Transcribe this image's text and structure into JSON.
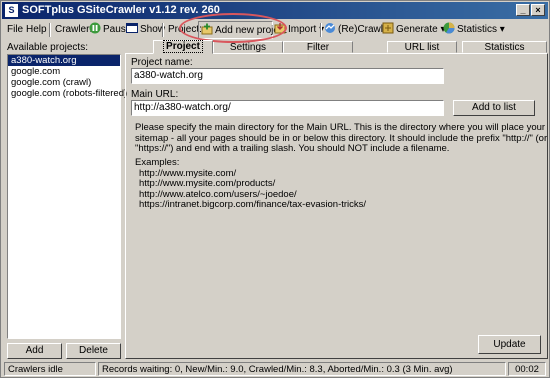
{
  "window": {
    "title": "SOFTplus GSiteCrawler v1.12 rev. 260"
  },
  "toolbar": {
    "file": "File",
    "help": "Help",
    "crawler_label": "Crawler:",
    "pause": "Pause",
    "show": "Show",
    "project_label": "Project:",
    "add_new_project": "Add new project",
    "import": "Import",
    "recrawl": "(Re)Crawl",
    "generate": "Generate",
    "statistics": "Statistics"
  },
  "sidebar": {
    "label": "Available projects:",
    "projects": [
      "a380-watch.org",
      "google.com",
      "google.com (crawl)",
      "google.com (robots-filtered)"
    ],
    "selected_index": 0,
    "add": "Add",
    "delete": "Delete"
  },
  "tabs": [
    "Project",
    "Settings",
    "Filter",
    "URL list",
    "Statistics"
  ],
  "active_tab": "Project",
  "project": {
    "name_label": "Project name:",
    "name_value": "a380-watch.org",
    "url_label": "Main URL:",
    "url_value": "http://a380-watch.org/",
    "add_to_list": "Add to list",
    "help_lines": [
      "Please specify the main directory for the Main URL. This is the directory where you will place your",
      "sitemap - all your pages should be in or below this directory. It should include the prefix \"http://\" (or",
      "\"https://\") and end with a trailing slash.  You should NOT include a filename."
    ],
    "examples_label": "Examples:",
    "examples": [
      "http://www.mysite.com/",
      "http://www.mysite.com/products/",
      "http://www.atelco.com/users/~joedoe/",
      "https://intranet.bigcorp.com/finance/tax-evasion-tricks/"
    ],
    "update": "Update"
  },
  "status": {
    "left": "Crawlers idle",
    "middle": "Records waiting: 0, New/Min.: 9.0, Crawled/Min.: 8.3, Aborted/Min.: 0.3 (3 Min. avg)",
    "time": "00:02"
  },
  "colors": {
    "titlebar": "#0a246a",
    "selection": "#0a246a",
    "annotation_circle": "#d9575d"
  }
}
